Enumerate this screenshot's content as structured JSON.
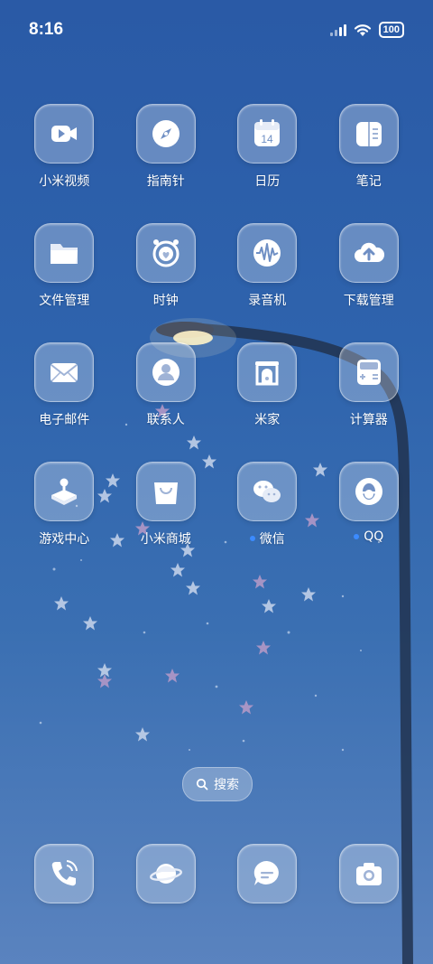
{
  "status": {
    "time": "8:16",
    "battery": "100"
  },
  "apps": [
    {
      "label": "小米视频",
      "icon": "video-camera-icon"
    },
    {
      "label": "指南针",
      "icon": "compass-icon"
    },
    {
      "label": "日历",
      "icon": "calendar-icon",
      "date": "14"
    },
    {
      "label": "笔记",
      "icon": "notes-icon"
    },
    {
      "label": "文件管理",
      "icon": "folder-icon"
    },
    {
      "label": "时钟",
      "icon": "alarm-clock-icon"
    },
    {
      "label": "录音机",
      "icon": "sound-wave-icon"
    },
    {
      "label": "下载管理",
      "icon": "cloud-upload-icon"
    },
    {
      "label": "电子邮件",
      "icon": "envelope-icon"
    },
    {
      "label": "联系人",
      "icon": "contact-icon"
    },
    {
      "label": "米家",
      "icon": "home-door-icon"
    },
    {
      "label": "计算器",
      "icon": "calculator-icon"
    },
    {
      "label": "游戏中心",
      "icon": "joystick-icon"
    },
    {
      "label": "小米商城",
      "icon": "shopping-bag-icon"
    },
    {
      "label": "微信",
      "icon": "wechat-icon",
      "badge": true
    },
    {
      "label": "QQ",
      "icon": "qq-penguin-icon",
      "badge": true
    }
  ],
  "search": {
    "label": "搜索",
    "icon": "search-icon"
  },
  "dock": [
    {
      "icon": "phone-icon"
    },
    {
      "icon": "browser-planet-icon"
    },
    {
      "icon": "messages-icon"
    },
    {
      "icon": "camera-icon"
    }
  ],
  "colors": {
    "badge": "#3c8bff",
    "wallpaper_top": "#2a5aa6",
    "wallpaper_bottom": "#5a83bf"
  }
}
